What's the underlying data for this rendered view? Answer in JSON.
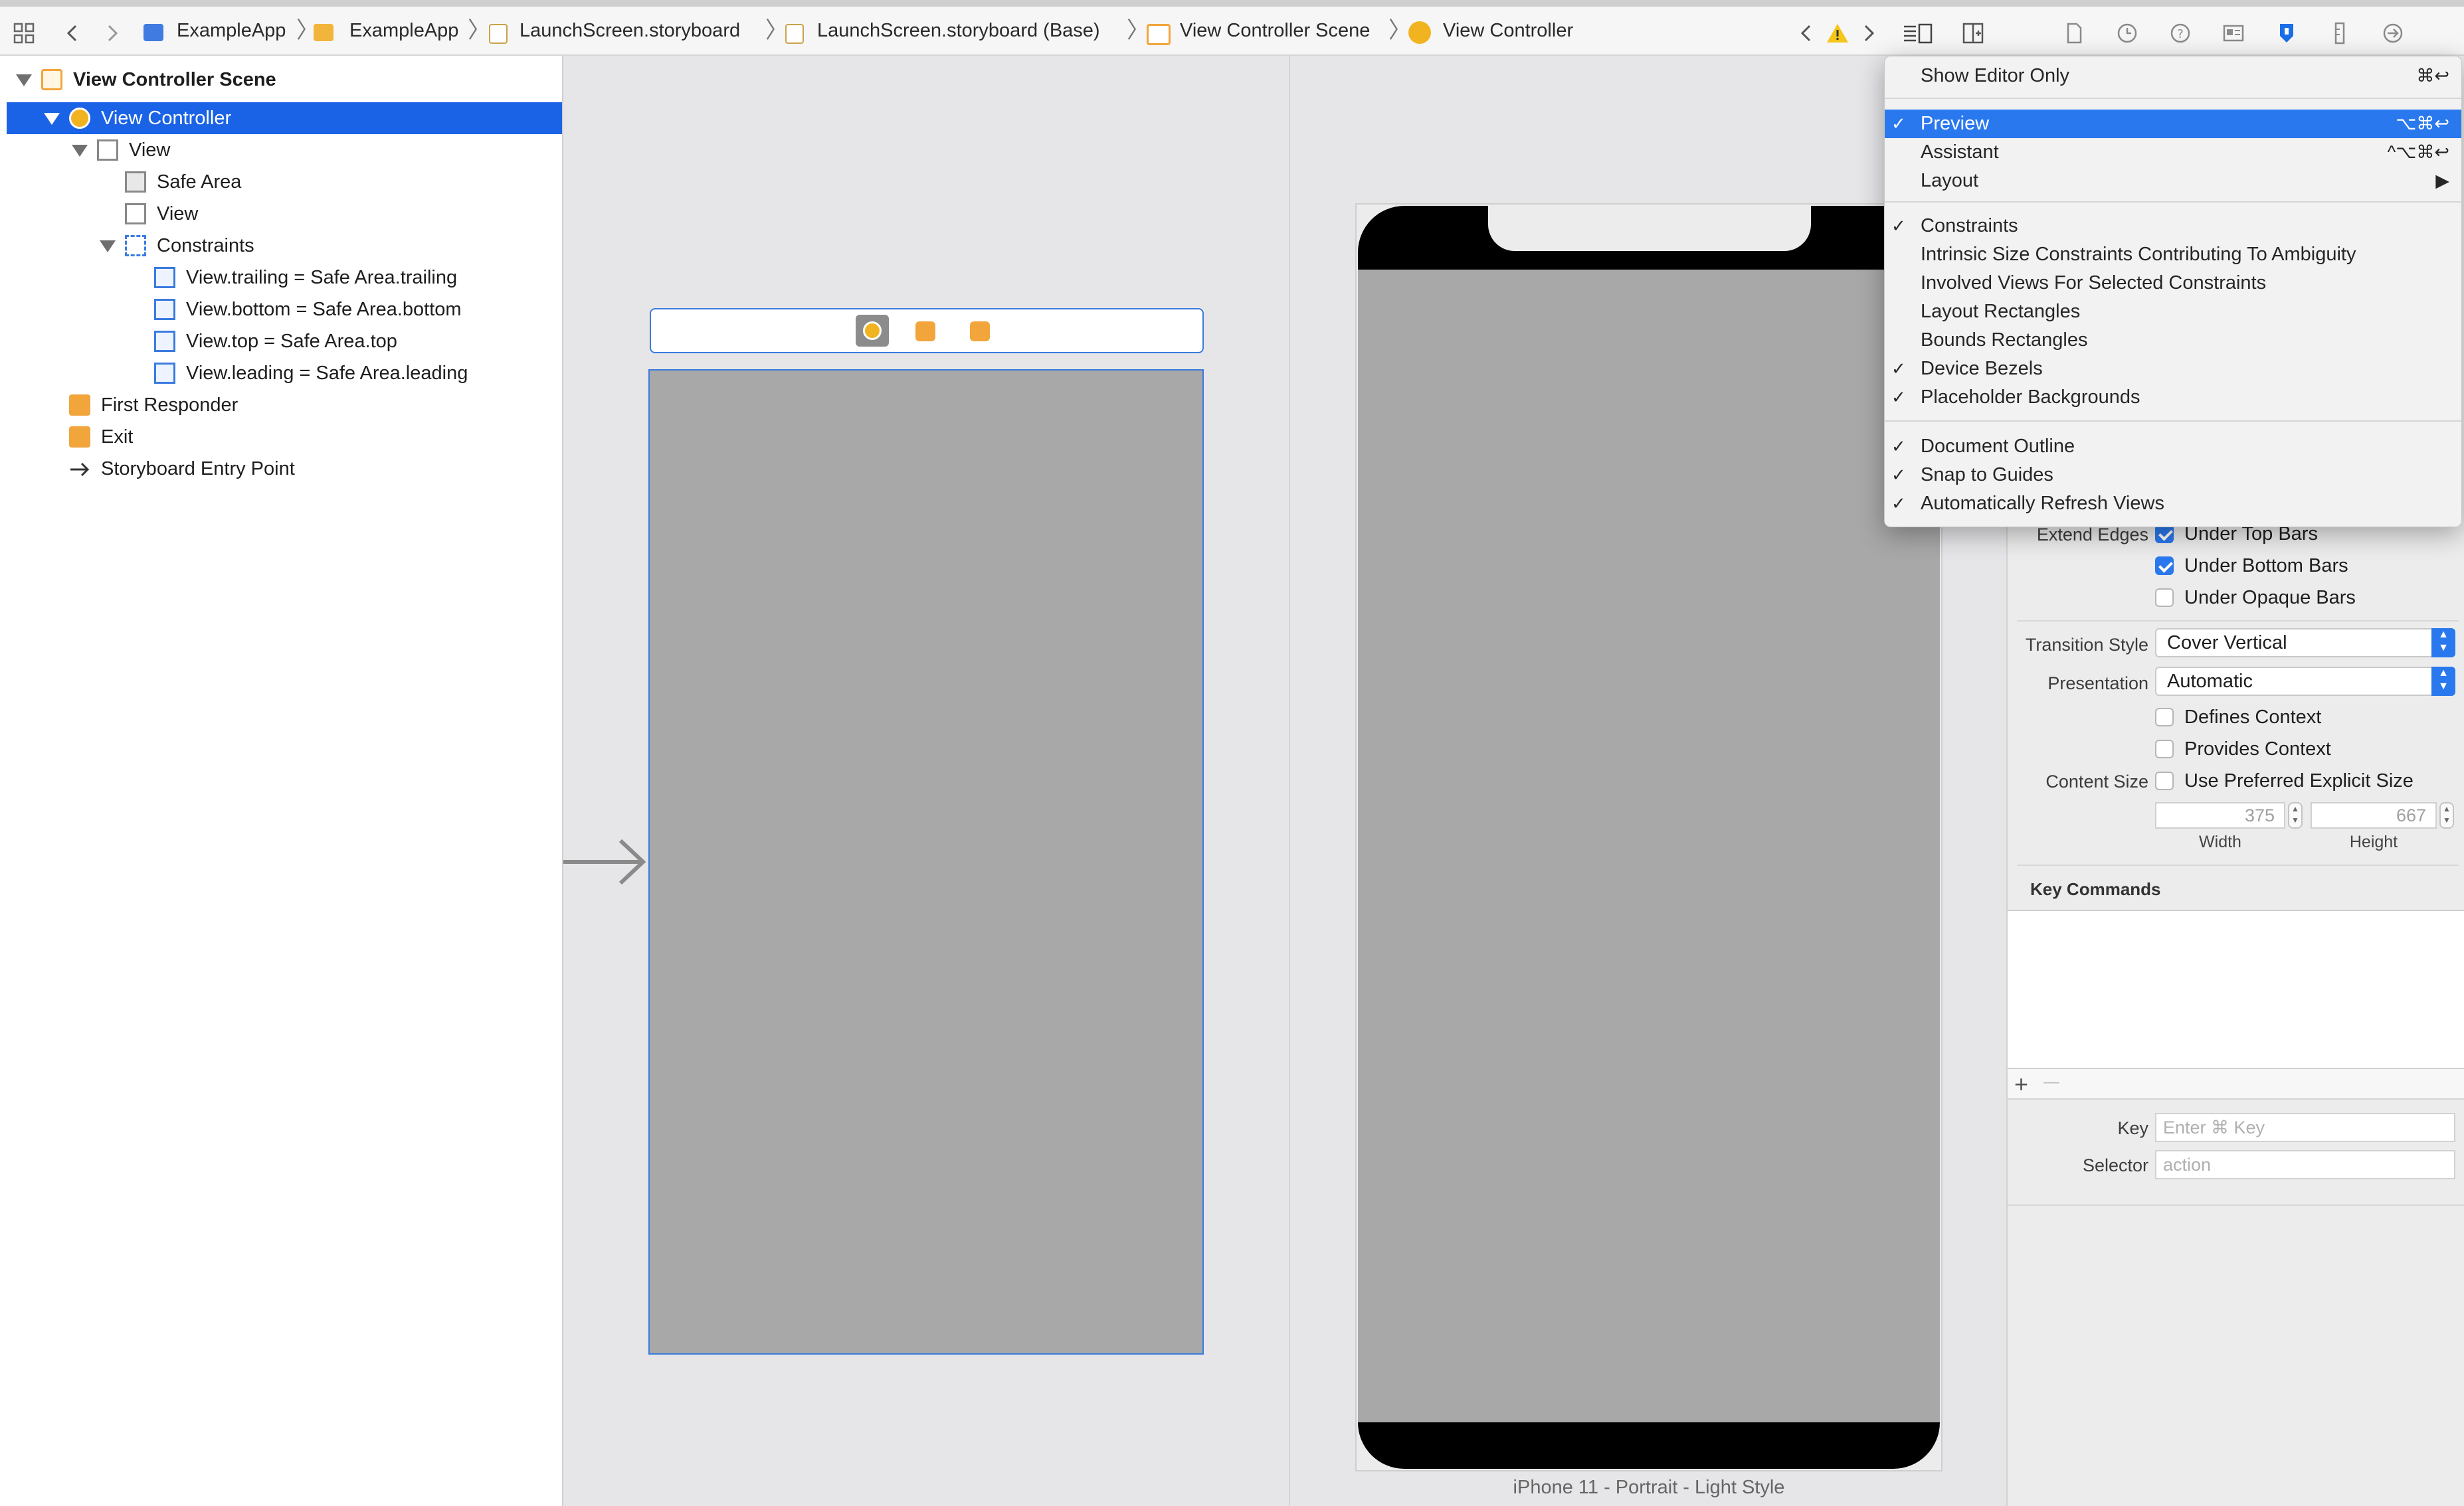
{
  "jump_bar": {
    "breadcrumbs": [
      "ExampleApp",
      "ExampleApp",
      "LaunchScreen.storyboard",
      "LaunchScreen.storyboard (Base)",
      "View Controller Scene",
      "View Controller"
    ],
    "separator": "〉"
  },
  "outline": {
    "items": [
      {
        "label": "View Controller Scene",
        "icon": "scene-icon"
      },
      {
        "label": "View Controller",
        "icon": "view-controller-icon"
      },
      {
        "label": "View",
        "icon": "view-icon"
      },
      {
        "label": "Safe Area",
        "icon": "safe-area-icon"
      },
      {
        "label": "View",
        "icon": "view-icon"
      },
      {
        "label": "Constraints",
        "icon": "constraints-icon"
      },
      {
        "label": "View.trailing = Safe Area.trailing",
        "icon": "constraint-trailing-icon"
      },
      {
        "label": "View.bottom = Safe Area.bottom",
        "icon": "constraint-bottom-icon"
      },
      {
        "label": "View.top = Safe Area.top",
        "icon": "constraint-top-icon"
      },
      {
        "label": "View.leading = Safe Area.leading",
        "icon": "constraint-leading-icon"
      },
      {
        "label": "First Responder",
        "icon": "first-responder-icon"
      },
      {
        "label": "Exit",
        "icon": "exit-icon"
      },
      {
        "label": "Storyboard Entry Point",
        "icon": "entry-arrow-icon"
      }
    ]
  },
  "preview": {
    "device_label": "iPhone 11 - Portrait - Light Style"
  },
  "inspector": {
    "extend_edges_label": "Extend Edges",
    "under_top_bars": "Under Top Bars",
    "under_bottom_bars": "Under Bottom Bars",
    "under_opaque_bars": "Under Opaque Bars",
    "transition_style_label": "Transition Style",
    "transition_style_value": "Cover Vertical",
    "presentation_label": "Presentation",
    "presentation_value": "Automatic",
    "defines_context": "Defines Context",
    "provides_context": "Provides Context",
    "content_size_label": "Content Size",
    "use_preferred_size": "Use Preferred Explicit Size",
    "width_value": "375",
    "height_value": "667",
    "width_label": "Width",
    "height_label": "Height",
    "key_commands_header": "Key Commands",
    "add_symbol": "+",
    "remove_symbol": "—",
    "key_label": "Key",
    "key_placeholder": "Enter ⌘ Key",
    "selector_label": "Selector",
    "selector_placeholder": "action"
  },
  "editor_menu": {
    "show_editor_only": {
      "label": "Show Editor Only",
      "shortcut": "⌘↩"
    },
    "preview": {
      "label": "Preview",
      "shortcut": "⌥⌘↩",
      "check": "✓"
    },
    "assistant": {
      "label": "Assistant",
      "shortcut": "^⌥⌘↩"
    },
    "layout": {
      "label": "Layout",
      "shortcut": "▶"
    },
    "constraints": {
      "label": "Constraints",
      "check": "✓"
    },
    "intrinsic": {
      "label": "Intrinsic Size Constraints Contributing To Ambiguity"
    },
    "involved_views": {
      "label": "Involved Views For Selected Constraints"
    },
    "layout_rectangles": {
      "label": "Layout Rectangles"
    },
    "bounds_rectangles": {
      "label": "Bounds Rectangles"
    },
    "device_bezels": {
      "label": "Device Bezels",
      "check": "✓"
    },
    "placeholder_backgrounds": {
      "label": "Placeholder Backgrounds",
      "check": "✓"
    },
    "document_outline": {
      "label": "Document Outline",
      "check": "✓"
    },
    "snap_to_guides": {
      "label": "Snap to Guides",
      "check": "✓"
    },
    "auto_refresh": {
      "label": "Automatically Refresh Views",
      "check": "✓"
    }
  },
  "colors": {
    "selection": "#1a62e6",
    "menu_highlight": "#2a78ee",
    "scene_orange": "#f2a53a",
    "placeholder_gray": "#a8a8a8"
  }
}
